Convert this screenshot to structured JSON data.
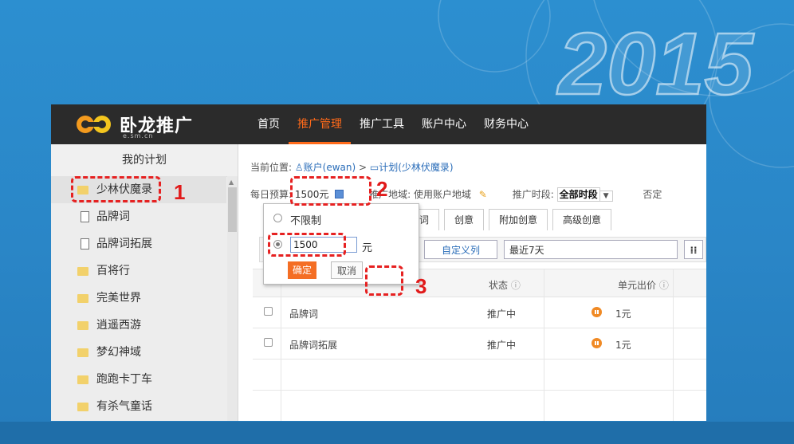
{
  "background": {
    "watermark_text": "2015",
    "accent": "#2c8fd0"
  },
  "brand": {
    "name": "卧龙推广",
    "domain": "e.sm.cn",
    "logo_colors": [
      "#f39a1e",
      "#f3c51e"
    ]
  },
  "nav": {
    "items": [
      {
        "label": "首页",
        "active": false
      },
      {
        "label": "推广管理",
        "active": true
      },
      {
        "label": "推广工具",
        "active": false
      },
      {
        "label": "账户中心",
        "active": false
      },
      {
        "label": "财务中心",
        "active": false
      }
    ],
    "active_color": "#ff6a1a"
  },
  "sidebar": {
    "title": "我的计划",
    "items": [
      {
        "label": "少林伏魔录",
        "icon": "folder-open-icon",
        "selected": true
      },
      {
        "label": "品牌词",
        "icon": "document-icon"
      },
      {
        "label": "品牌词拓展",
        "icon": "document-icon"
      },
      {
        "label": "百将行",
        "icon": "folder-icon"
      },
      {
        "label": "完美世界",
        "icon": "folder-icon"
      },
      {
        "label": "逍遥西游",
        "icon": "folder-icon"
      },
      {
        "label": "梦幻神域",
        "icon": "folder-icon"
      },
      {
        "label": "跑跑卡丁车",
        "icon": "folder-icon"
      },
      {
        "label": "有杀气童话",
        "icon": "folder-icon"
      }
    ]
  },
  "breadcrumb": {
    "prefix": "当前位置:",
    "account": "账户(ewan)",
    "sep": ">",
    "plan": "计划(少林伏魔录)"
  },
  "info": {
    "budget_label": "每日预算:",
    "budget_value": "1500元",
    "region_label": "推广地域:",
    "region_value": "使用账户地域",
    "period_label": "推广时段:",
    "period_value": "全部时段",
    "truncated_label": "否定"
  },
  "tabs": [
    "关键词",
    "创意",
    "附加创意",
    "高级创意"
  ],
  "toolbar": {
    "button_partial": "理",
    "custom_columns": "自定义列",
    "date_range": "最近7天"
  },
  "table": {
    "headers": {
      "status": "状态",
      "unit_bid": "单元出价"
    },
    "rows": [
      {
        "name": "品牌词",
        "status": "推广中",
        "bid": "1元"
      },
      {
        "name": "品牌词拓展",
        "status": "推广中",
        "bid": "1元"
      }
    ]
  },
  "popup": {
    "option_unlimited": "不限制",
    "input_value": "1500",
    "unit": "元",
    "ok": "确定",
    "cancel": "取消"
  },
  "annotations": {
    "n1": "1",
    "n2": "2",
    "n3": "3",
    "color": "#e62121"
  }
}
